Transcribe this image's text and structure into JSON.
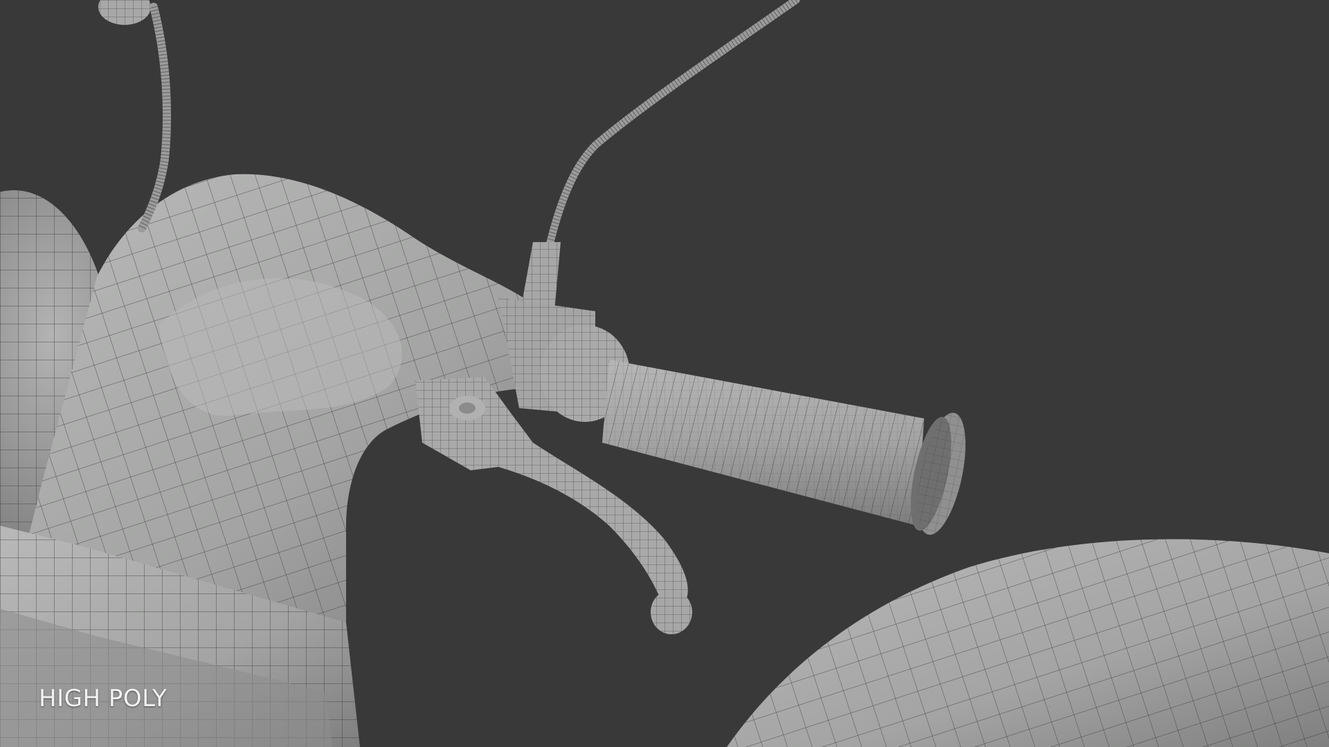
{
  "viewport": {
    "background": "#393939",
    "mesh_fill": "#a9aaa9",
    "wire_color": "#2a2a2a"
  },
  "caption": {
    "label": "HIGH POLY"
  }
}
